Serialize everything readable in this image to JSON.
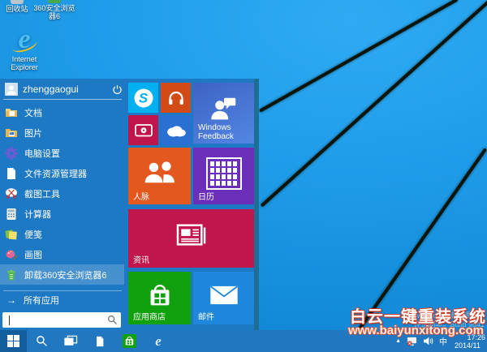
{
  "desktop": {
    "icons": {
      "recycle_bin": "回收站",
      "browser360": "360安全浏览器6",
      "ie": "Internet Explorer"
    },
    "watermark_title": "白云一键重装系统",
    "watermark_url": "www.baiyunxitong.com",
    "eval_line1": "Windows 技术预览版",
    "eval_line2": "评估副本。Build 9841"
  },
  "start_menu": {
    "user_name": "zhenggaogui",
    "items": [
      {
        "icon": "documents-folder-icon",
        "label": "文档"
      },
      {
        "icon": "pictures-folder-icon",
        "label": "图片"
      },
      {
        "icon": "gear-icon",
        "label": "电脑设置"
      },
      {
        "icon": "file-explorer-icon",
        "label": "文件资源管理器"
      },
      {
        "icon": "snipping-tool-icon",
        "label": "截图工具"
      },
      {
        "icon": "calculator-icon",
        "label": "计算器"
      },
      {
        "icon": "sticky-notes-icon",
        "label": "便笺"
      },
      {
        "icon": "paint-icon",
        "label": "画图"
      },
      {
        "icon": "uninstall-bin-icon",
        "label": "卸载360安全浏览器6"
      }
    ],
    "all_apps_label": "所有应用",
    "search_placeholder": "",
    "tiles": {
      "skype_letter": "S",
      "windows_feedback": "Windows Feedback",
      "people": "人脉",
      "calendar": "日历",
      "news": "资讯",
      "store": "应用商店",
      "mail": "邮件"
    }
  },
  "taskbar": {
    "ie_letter": "e",
    "tray": {
      "language": "中",
      "time": "17:26",
      "date": "2014/11"
    }
  },
  "colors": {
    "desktop_blue": "#1f9ce9",
    "menu_bg": "#1e79c4",
    "menu_edge": "#1d6d94",
    "taskbar_bg": "#2278c0",
    "start_button_bg": "#135d9d",
    "tile_skype": "#00b0f0",
    "tile_music": "#d24b17",
    "tile_feedback": "#4472d8",
    "tile_camera": "#c0154a",
    "tile_onedrive": "#2a6fd2",
    "tile_people": "#e2581f",
    "tile_calendar": "#6c2fb9",
    "tile_news": "#c0164b",
    "tile_store": "#12a10e",
    "tile_mail": "#1e87dc",
    "watermark_red": "#d8341c"
  }
}
